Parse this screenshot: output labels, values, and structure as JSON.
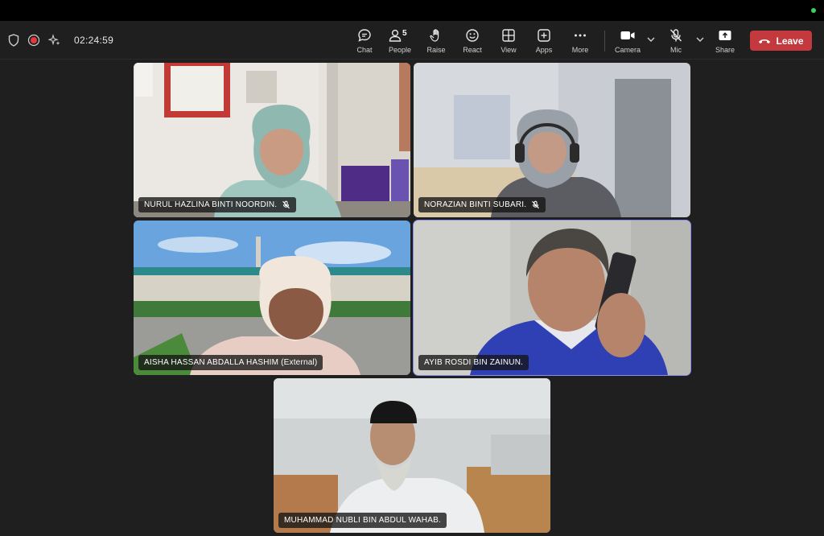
{
  "meeting": {
    "timer": "02:24:59"
  },
  "toolbar": {
    "chat_label": "Chat",
    "people_label": "People",
    "people_count": "5",
    "raise_label": "Raise",
    "react_label": "React",
    "view_label": "View",
    "apps_label": "Apps",
    "more_label": "More",
    "camera_label": "Camera",
    "mic_label": "Mic",
    "share_label": "Share",
    "leave_label": "Leave"
  },
  "participants": [
    {
      "name": "NURUL HAZLINA BINTI NOORDIN.",
      "muted": true
    },
    {
      "name": "NORAZIAN BINTI SUBARI.",
      "muted": true
    },
    {
      "name": "AISHA HASSAN ABDALLA HASHIM (External)",
      "muted": false
    },
    {
      "name": "AYIB ROSDI BIN ZAINUN.",
      "muted": false,
      "speaking": true
    },
    {
      "name": "MUHAMMAD NUBLI BIN ABDUL WAHAB.",
      "muted": false
    }
  ],
  "colors": {
    "leave": "#c4393d",
    "active_border": "#8a8cf0",
    "background": "#1f1f1f"
  }
}
